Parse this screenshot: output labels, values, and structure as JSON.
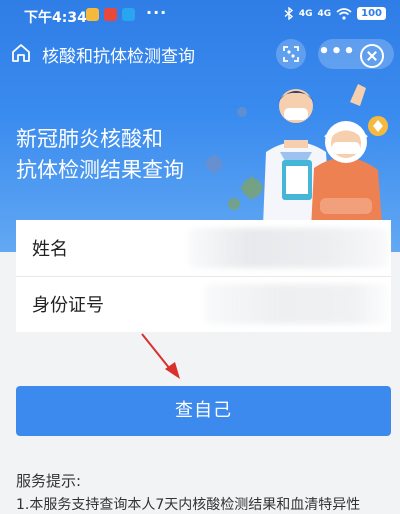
{
  "status_bar": {
    "time": "下午4:34",
    "more": "···",
    "signal_1": "4G",
    "signal_2": "4G",
    "battery": "100"
  },
  "nav": {
    "title": "核酸和抗体检测查询",
    "more": "•••"
  },
  "hero": {
    "title_line_1": "新冠肺炎核酸和",
    "title_line_2": "抗体检测结果查询"
  },
  "form": {
    "name_label": "姓名",
    "id_label": "身份证号"
  },
  "query_button": "查自己",
  "tips": {
    "title": "服务提示:",
    "line_1": "1.本服务支持查询本人7天内核酸检测结果和血清特异性"
  },
  "colors": {
    "primary": "#3c8aee",
    "hero_top": "#2f7de6",
    "arrow": "#d9302c"
  }
}
